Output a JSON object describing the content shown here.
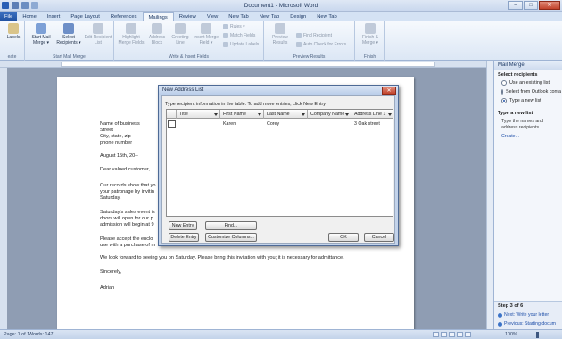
{
  "window": {
    "title": "Document1 - Microsoft Word",
    "buttons": {
      "minimize": "–",
      "maximize": "□",
      "close": "✕"
    }
  },
  "tabs": [
    {
      "label": "File"
    },
    {
      "label": "Home"
    },
    {
      "label": "Insert"
    },
    {
      "label": "Page Layout"
    },
    {
      "label": "References"
    },
    {
      "label": "Mailings"
    },
    {
      "label": "Review"
    },
    {
      "label": "View"
    },
    {
      "label": "New Tab"
    },
    {
      "label": "New Tab"
    },
    {
      "label": "Design"
    },
    {
      "label": "New Tab"
    }
  ],
  "ribbon": {
    "create": {
      "labels_btn": "Labels",
      "group": "eate"
    },
    "start": {
      "mail_merge": "Start Mail Merge ▾",
      "select_recipients": "Select Recipients ▾",
      "edit_list": "Edit Recipient List",
      "group": "Start Mail Merge"
    },
    "write": {
      "highlight": "Highlight Merge Fields",
      "address": "Address Block",
      "greeting": "Greeting Line",
      "insert_field": "Insert Merge Field ▾",
      "rules": "Rules ▾",
      "match": "Match Fields",
      "update": "Update Labels",
      "group": "Write & Insert Fields"
    },
    "preview": {
      "preview_results": "Preview Results",
      "find": "Find Recipient",
      "auto_check": "Auto Check for Errors",
      "group": "Preview Results"
    },
    "finish": {
      "finish_merge": "Finish & Merge ▾",
      "group": "Finish"
    }
  },
  "document": {
    "lines": [
      "Name of business",
      "Street",
      "City, state, zip",
      "phone number",
      "August 15th, 20--",
      "Dear valued customer,",
      "Our records show that yo",
      "your patronage by invitin",
      "Saturday.",
      "Saturday's sales event is",
      "doors will open for our p",
      "admission will begin at 9",
      "Please accept the enclo",
      "use with a purchase of m",
      "We look forward to seeing you on Saturday. Please bring this invitation with you; it is necessary for admittance.",
      "Sincerely,",
      "Adrian"
    ]
  },
  "dialog": {
    "title": "New Address List",
    "close": "✕",
    "instruction": "Type recipient information in the table.  To add more entries, click New Entry.",
    "columns": [
      "Title",
      "First Name",
      "Last Name",
      "Company Name",
      "Address Line 1"
    ],
    "rows": [
      {
        "title": "",
        "first": "Karen",
        "last": "Corey",
        "company": "",
        "address": "3 Oak street"
      }
    ],
    "buttons": {
      "new_entry": "New Entry",
      "find": "Find...",
      "delete_entry": "Delete Entry",
      "customize": "Customize Columns...",
      "ok": "OK",
      "cancel": "Cancel"
    }
  },
  "pane": {
    "title": "Mail Merge",
    "select_heading": "Select recipients",
    "options": [
      "Use an existing list",
      "Select from Outlook conta",
      "Type a new list"
    ],
    "selected_option": 2,
    "type_heading": "Type a new list",
    "type_desc": "Type the names and address recipients.",
    "create_link": "Create...",
    "step": "Step 3 of 6",
    "next": "Next: Write your letter",
    "previous": "Previous: Starting docum"
  },
  "status": {
    "page": "Page: 1 of 1",
    "words": "Words: 147",
    "zoom": "100%"
  }
}
